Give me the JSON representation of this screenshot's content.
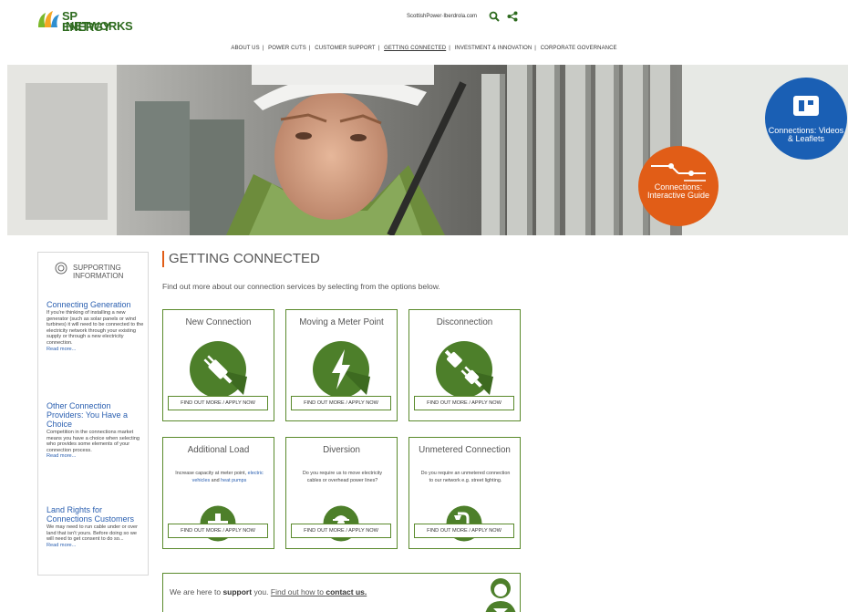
{
  "brand": {
    "line1": "SP ENERGY",
    "line2": "NETWORKS"
  },
  "top_links": {
    "scottishpower": "ScottishPower",
    "sep": " · ",
    "iberdrola": "Iberdrola.com"
  },
  "nav": [
    {
      "label": "About Us"
    },
    {
      "label": "Power Cuts"
    },
    {
      "label": "Customer Support"
    },
    {
      "label": "Getting Connected",
      "active": true
    },
    {
      "label": "Investment & Innovation"
    },
    {
      "label": "Corporate Governance"
    }
  ],
  "nav_sep": "|",
  "hero": {
    "cta_orange": "Connections: Interactive Guide",
    "cta_blue": "Connections: Videos & Leaflets"
  },
  "sidebar": {
    "heading": "Supporting Information",
    "items": [
      {
        "title": "Connecting Generation",
        "body": "If you're thinking of installing a new generator (such as solar panels or wind turbines) it will need to be connected to the electricity network through your existing supply or through a new electricity connection.",
        "more": "Read more..."
      },
      {
        "title": "Other Connection Providers: You Have a Choice",
        "body": "Competition in the connections market means you have a choice when selecting who provides some elements of your connection process.",
        "more": "Read more..."
      },
      {
        "title": "Land Rights for Connections Customers",
        "body": "We may need to run cable under or over land that isn't yours. Before doing so we will need to get consent to do so...",
        "more": "Read more..."
      }
    ]
  },
  "page_title": "Getting Connected",
  "intro": "Find out more about our connection services by selecting from the options below.",
  "cards": [
    {
      "title": "New Connection",
      "button": "Find out more / apply now",
      "icon": "plug-icon"
    },
    {
      "title": "Moving a Meter Point",
      "button": "Find out more / apply now",
      "icon": "lightning-icon"
    },
    {
      "title": "Disconnection",
      "button": "Find out more / apply now",
      "icon": "unplug-icon"
    },
    {
      "title": "Additional Load",
      "desc_a": "Increase capacity at meter point, ",
      "desc_link1": "electric vehicles",
      "desc_b": " and ",
      "desc_link2": "heat pumps",
      "button": "Find out more / apply now",
      "icon": "plus-icon"
    },
    {
      "title": "Diversion",
      "desc": "Do you require us to move electricity cables or overhead power lines?",
      "button": "Find out more / apply now",
      "icon": "worker-icon"
    },
    {
      "title": "Unmetered Connection",
      "desc": "Do you require an unmetered connection to our network e.g. street lighting.",
      "button": "Find out more / apply now",
      "icon": "streetlight-icon"
    }
  ],
  "support": {
    "pre": "We are here to ",
    "strong": "support",
    "post": " you. ",
    "link_pre": "Find out how to ",
    "link_strong": "contact us."
  },
  "colors": {
    "green": "#5a8a2c",
    "dark_green": "#2e6b1f",
    "orange": "#e15d17",
    "blue": "#1a5fb4",
    "link": "#2a5fb0"
  }
}
